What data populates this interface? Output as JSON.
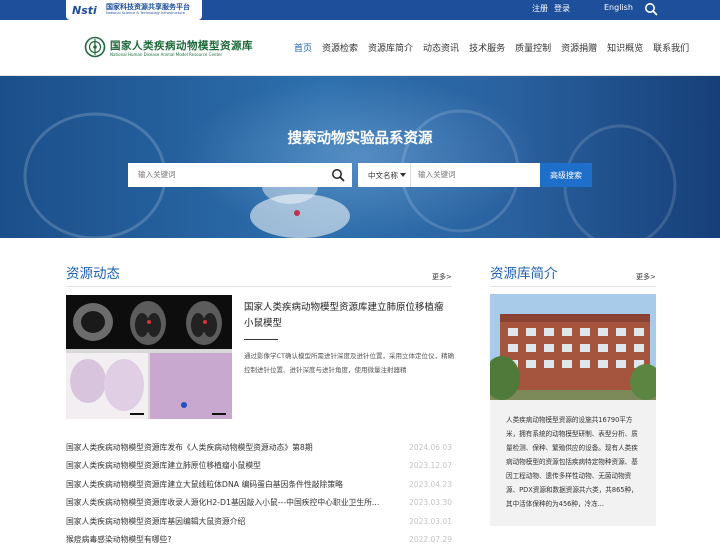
{
  "topbar": {
    "platform_mark": "Nsti",
    "platform_name": "国家科技资源共享服务平台",
    "platform_name_en": "National Science & Technology Infrastructure",
    "register": "注册",
    "login": "登录",
    "language": "English"
  },
  "header": {
    "site_title": "国家人类疾病动物模型资源库",
    "site_subtitle": "National Human Disease Animal Model Resource Center",
    "nav": [
      "首页",
      "资源检索",
      "资源库简介",
      "动态资讯",
      "技术服务",
      "质量控制",
      "资源捐赠",
      "知识概览",
      "联系我们"
    ]
  },
  "banner": {
    "title": "搜索动物实验品系资源",
    "search_placeholder": "输入关键词",
    "select_value": "中文名称",
    "search2_placeholder": "输入关键词",
    "advanced_search": "高级搜索"
  },
  "news": {
    "title": "资源动态",
    "more": "更多>",
    "featured": {
      "title": "国家人类疾病动物模型资源库建立肺原位移植瘤小鼠模型",
      "desc": "通过影像学CT确认模型所需进针深度及进针位置，采用立体定位仪，精确控制进针位置、进针深度与进针角度，使用微量注射器精"
    },
    "items": [
      {
        "title": "国家人类疾病动物模型资源库发布《人类疾病动物模型资源动态》第8期",
        "date": "2024.06.03"
      },
      {
        "title": "国家人类疾病动物模型资源库建立肺原位移植瘤小鼠模型",
        "date": "2023.12.07"
      },
      {
        "title": "国家人类疾病动物模型资源库建立大鼠线粒体DNA 编码蛋白基因条件性敲除策略",
        "date": "2023.04.23"
      },
      {
        "title": "国家人类疾病动物模型资源库收录人源化H2-D1基因敲入小鼠---中国疾控中心职业卫生所...",
        "date": "2023.03.30"
      },
      {
        "title": "国家人类疾病动物模型资源库基因编辑大鼠资源介绍",
        "date": "2023.03.01"
      },
      {
        "title": "猴痘病毒感染动物模型有哪些?",
        "date": "2022.07.29"
      }
    ]
  },
  "intro": {
    "title": "资源库简介",
    "more": "更多>",
    "text": "人类疾病动物模型资源的设施共16790平方米，拥有系统的动物模型研制、表型分析、质量检测、保种、繁殖供应的设备。现有人类疾病动物模型的资源包括疾病特定物种资源、基因工程动物、遗传多样性动物、无菌动物资源、PDX资源和数据资源共六类，共865种，其中活体保种的为456种，冷冻..."
  },
  "colors": {
    "primary": "#1d5fb2",
    "topbar": "#1d4f9b",
    "button": "#1d6fc9",
    "logo_green": "#1f6a3b"
  }
}
